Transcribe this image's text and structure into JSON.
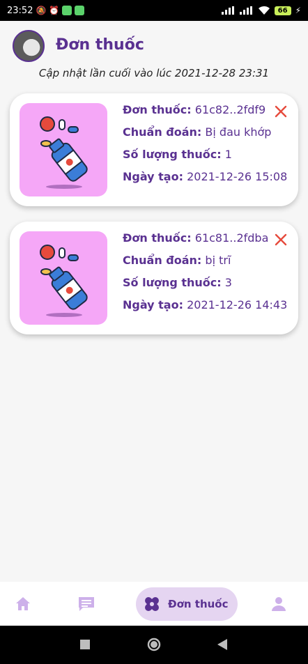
{
  "status_bar": {
    "time": "23:52",
    "battery": "66"
  },
  "header": {
    "title": "Đơn thuốc",
    "last_updated": "Cập nhật lần cuối vào lúc 2021-12-28 23:31"
  },
  "prescriptions": [
    {
      "id_label": "Đơn thuốc:",
      "id_value": "61c82..2fdf9",
      "diagnosis_label": "Chuẩn đoán:",
      "diagnosis_value": "Bị đau khớp",
      "qty_label": "Số lượng thuốc:",
      "qty_value": "1",
      "date_label": "Ngày tạo:",
      "date_value": "2021-12-26 15:08"
    },
    {
      "id_label": "Đơn thuốc:",
      "id_value": "61c81..2fdba",
      "diagnosis_label": "Chuẩn đoán:",
      "diagnosis_value": "bị trĩ",
      "qty_label": "Số lượng thuốc:",
      "qty_value": "3",
      "date_label": "Ngày tạo:",
      "date_value": "2021-12-26 14:43"
    }
  ],
  "bottom_nav": {
    "active_label": "Đơn thuốc",
    "items": [
      {
        "icon": "home-icon"
      },
      {
        "icon": "chat-icon"
      },
      {
        "icon": "prescription-icon"
      },
      {
        "icon": "profile-icon"
      }
    ]
  },
  "colors": {
    "primary": "#5a3191",
    "close": "#e64a3c",
    "thumb_bg": "#f5a7f7",
    "nav_active_bg": "#e5d5f1"
  }
}
